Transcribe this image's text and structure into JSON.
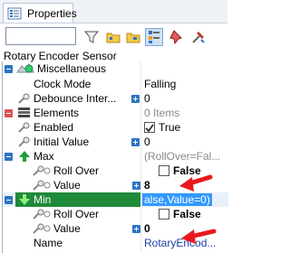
{
  "tab": {
    "label": "Properties"
  },
  "search": {
    "value": ""
  },
  "object_name": "Rotary Encoder Sensor",
  "rows": {
    "misc": "Miscellaneous",
    "clock_mode": {
      "name": "Clock Mode",
      "value": "Falling"
    },
    "debounce": {
      "name": "Debounce Inter...",
      "value": "0"
    },
    "elements": {
      "name": "Elements",
      "value": "0 Items"
    },
    "enabled": {
      "name": "Enabled",
      "value": "True"
    },
    "initial": {
      "name": "Initial Value",
      "value": "0"
    },
    "max": {
      "name": "Max",
      "value": "(RollOver=Fal..."
    },
    "max_rollover": {
      "name": "Roll Over",
      "value": "False"
    },
    "max_value": {
      "name": "Value",
      "value": "8"
    },
    "min": {
      "name": "Min",
      "value": "alse,Value=0)"
    },
    "min_rollover": {
      "name": "Roll Over",
      "value": "False"
    },
    "min_value": {
      "name": "Value",
      "value": "0"
    },
    "name": {
      "name": "Name",
      "value": "RotaryEncod..."
    }
  },
  "colors": {
    "accent": "#3399ff",
    "arrow": "#e8191e",
    "plus_button": "#2e74c0"
  }
}
